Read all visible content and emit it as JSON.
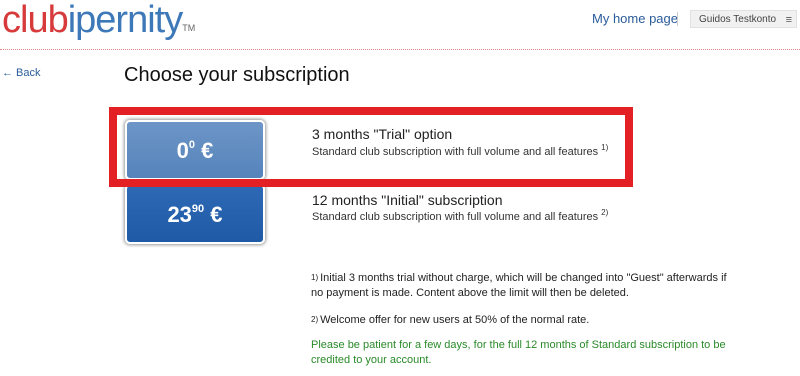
{
  "header": {
    "logo_club": "club",
    "logo_ipernity": "ipernity",
    "logo_tm": "TM",
    "home_link": "My home page",
    "user_name": "Guidos Testkonto",
    "menu_icon": "≡"
  },
  "nav": {
    "back_label": "← Back"
  },
  "page": {
    "title": "Choose your subscription"
  },
  "plans": [
    {
      "price_main": "0",
      "price_sup": "0",
      "currency": "€",
      "title": "3 months \"Trial\" option",
      "description": "Standard club subscription with full volume and all features",
      "footnote": "1)",
      "color": "#5f8dc2",
      "highlighted": true,
      "highlight_color": "#e32024"
    },
    {
      "price_main": "23",
      "price_sup": "90",
      "currency": "€",
      "title": "12 months \"Initial\" subscription",
      "description": "Standard club subscription with full volume and all features",
      "footnote": "2)",
      "color": "#2762ad"
    }
  ],
  "notes": [
    {
      "marker": "1)",
      "text": "Initial 3 months trial without charge, which will be changed into \"Guest\" afterwards if no payment is made. Content above the limit will then be deleted."
    },
    {
      "marker": "2)",
      "text": "Welcome offer for new users at 50% of the normal rate."
    }
  ],
  "green_note": "Please be patient for a few days, for the full 12 months of Standard subscription to be credited to your account."
}
